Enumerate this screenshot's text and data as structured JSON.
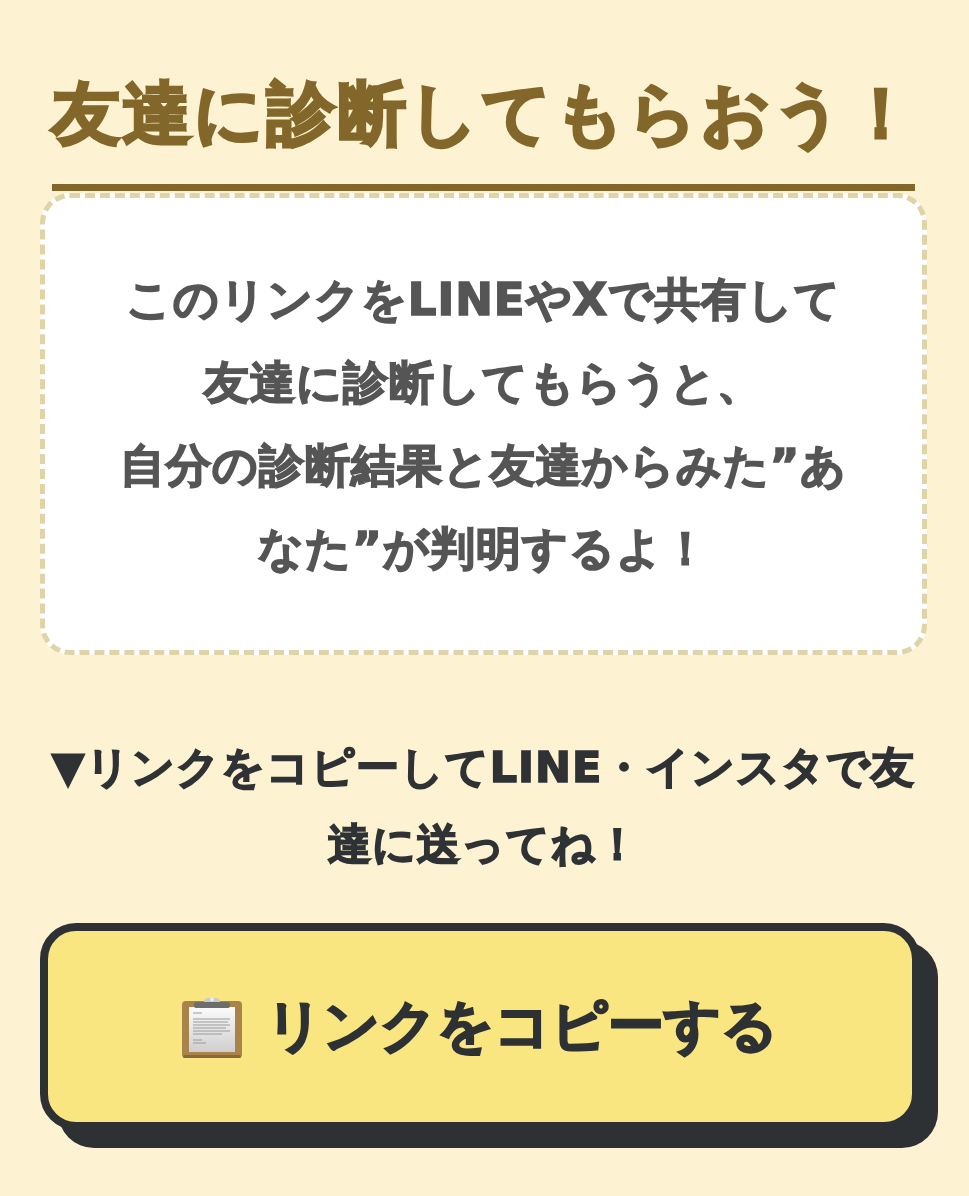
{
  "heading": {
    "text": "友達に診断してもらおう！"
  },
  "share_card": {
    "lines": [
      "このリンクをLINEやXで共有して",
      "友達に診断してもらうと、",
      "自分の診断結果と友達からみた”あ",
      "なた”が判明するよ！"
    ]
  },
  "instruction": {
    "lines": [
      "▼リンクをコピーしてLINE・インスタで友",
      "達に送ってね！"
    ]
  },
  "copy_button": {
    "label": "リンクをコピーする"
  }
}
